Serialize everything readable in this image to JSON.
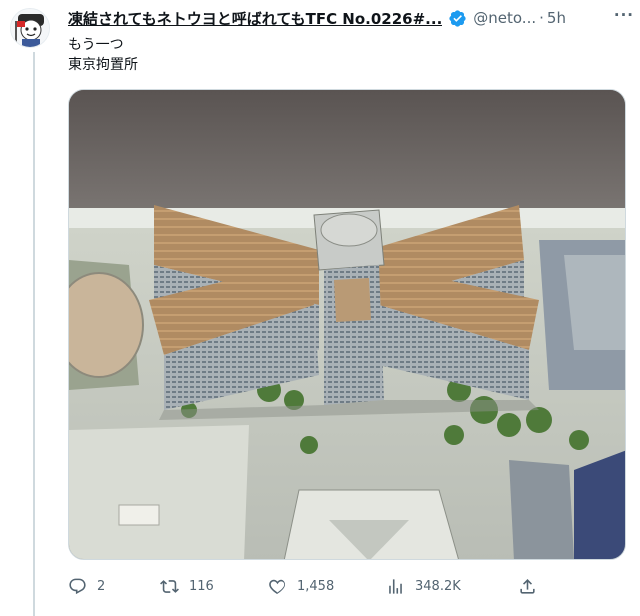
{
  "tweet": {
    "display_name": "凍結されてもネトウヨと呼ばれてもTFC No.0226#...",
    "handle": "@neto...",
    "separator": "·",
    "time": "5h",
    "more": "···",
    "text_lines": [
      "もう一つ",
      "東京拘置所"
    ],
    "media_alt": "東京拘置所"
  },
  "actions": {
    "replies": "2",
    "retweets": "116",
    "likes": "1,458",
    "views": "348.2K"
  },
  "colors": {
    "secondary_text": "#536471",
    "verified_blue": "#1d9bf0",
    "thread_line": "#cfd9de"
  },
  "icons": [
    "reply-icon",
    "retweet-icon",
    "like-icon",
    "views-icon",
    "share-icon",
    "verified-icon",
    "more-icon"
  ]
}
